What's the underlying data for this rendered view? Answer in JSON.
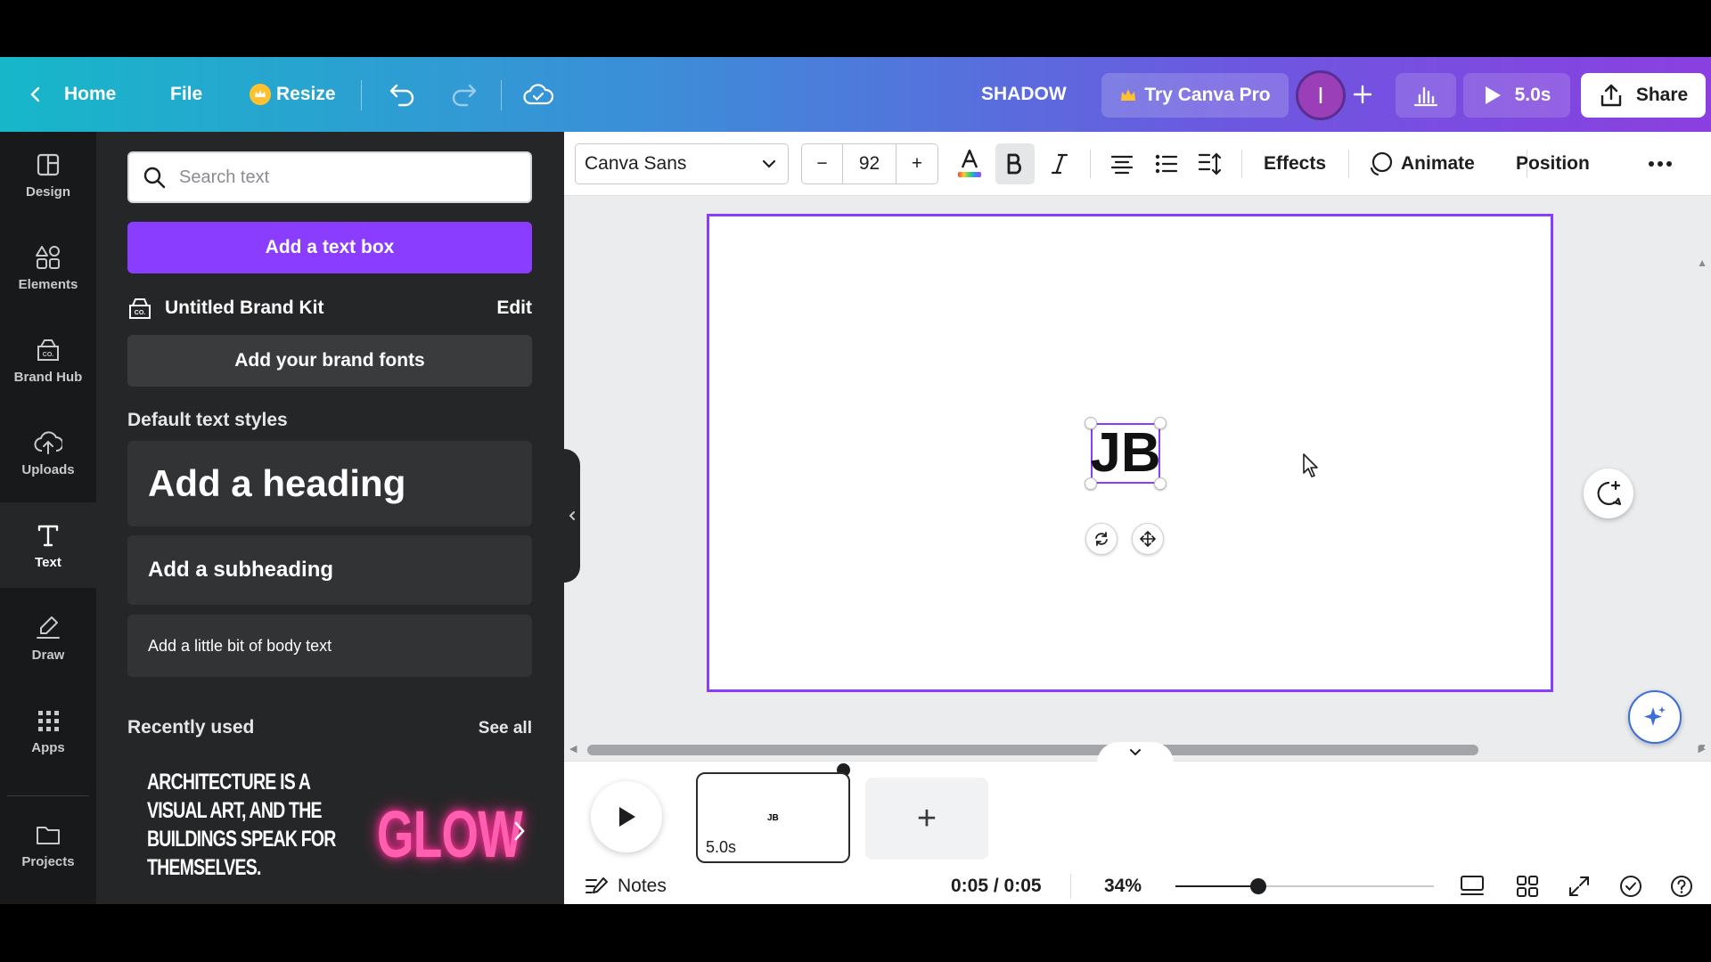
{
  "header": {
    "home": "Home",
    "file": "File",
    "resize": "Resize",
    "design_title": "SHADOW",
    "try_pro": "Try Canva Pro",
    "avatar_initial": "I",
    "play_duration": "5.0s",
    "share": "Share"
  },
  "rail": {
    "items": [
      {
        "label": "Design",
        "icon": "layout-icon"
      },
      {
        "label": "Elements",
        "icon": "shapes-icon"
      },
      {
        "label": "Brand Hub",
        "icon": "brand-icon"
      },
      {
        "label": "Uploads",
        "icon": "cloud-upload-icon"
      },
      {
        "label": "Text",
        "icon": "text-icon"
      },
      {
        "label": "Draw",
        "icon": "pen-icon"
      },
      {
        "label": "Apps",
        "icon": "grid-icon"
      },
      {
        "label": "Projects",
        "icon": "folder-icon"
      }
    ],
    "active": "Text"
  },
  "panel": {
    "search_placeholder": "Search text",
    "add_text_box": "Add a text box",
    "brand_kit": "Untitled Brand Kit",
    "brand_edit": "Edit",
    "add_brand_fonts": "Add your brand fonts",
    "default_styles_title": "Default text styles",
    "heading": "Add a heading",
    "subheading": "Add a subheading",
    "body": "Add a little bit of body text",
    "recently_used": "Recently used",
    "see_all": "See all",
    "recent_quote_lines": [
      "ARCHITECTURE IS A",
      "VISUAL ART, AND THE",
      "BUILDINGS SPEAK FOR",
      "THEMSELVES."
    ],
    "recent_glow": "GLOW"
  },
  "toolbar": {
    "font": "Canva Sans",
    "minus": "−",
    "font_size": "92",
    "plus": "+",
    "effects": "Effects",
    "animate": "Animate",
    "position": "Position"
  },
  "canvas": {
    "text": "JB"
  },
  "timeline": {
    "page_mini_text": "JB",
    "page_duration": "5.0s",
    "add": "+"
  },
  "bottombar": {
    "notes": "Notes",
    "time": "0:05 / 0:05",
    "zoom": "34%",
    "zoom_level": 0.32
  },
  "colors": {
    "accent": "#8b3dff",
    "panel_bg": "#252627",
    "rail_bg": "#18191b"
  }
}
